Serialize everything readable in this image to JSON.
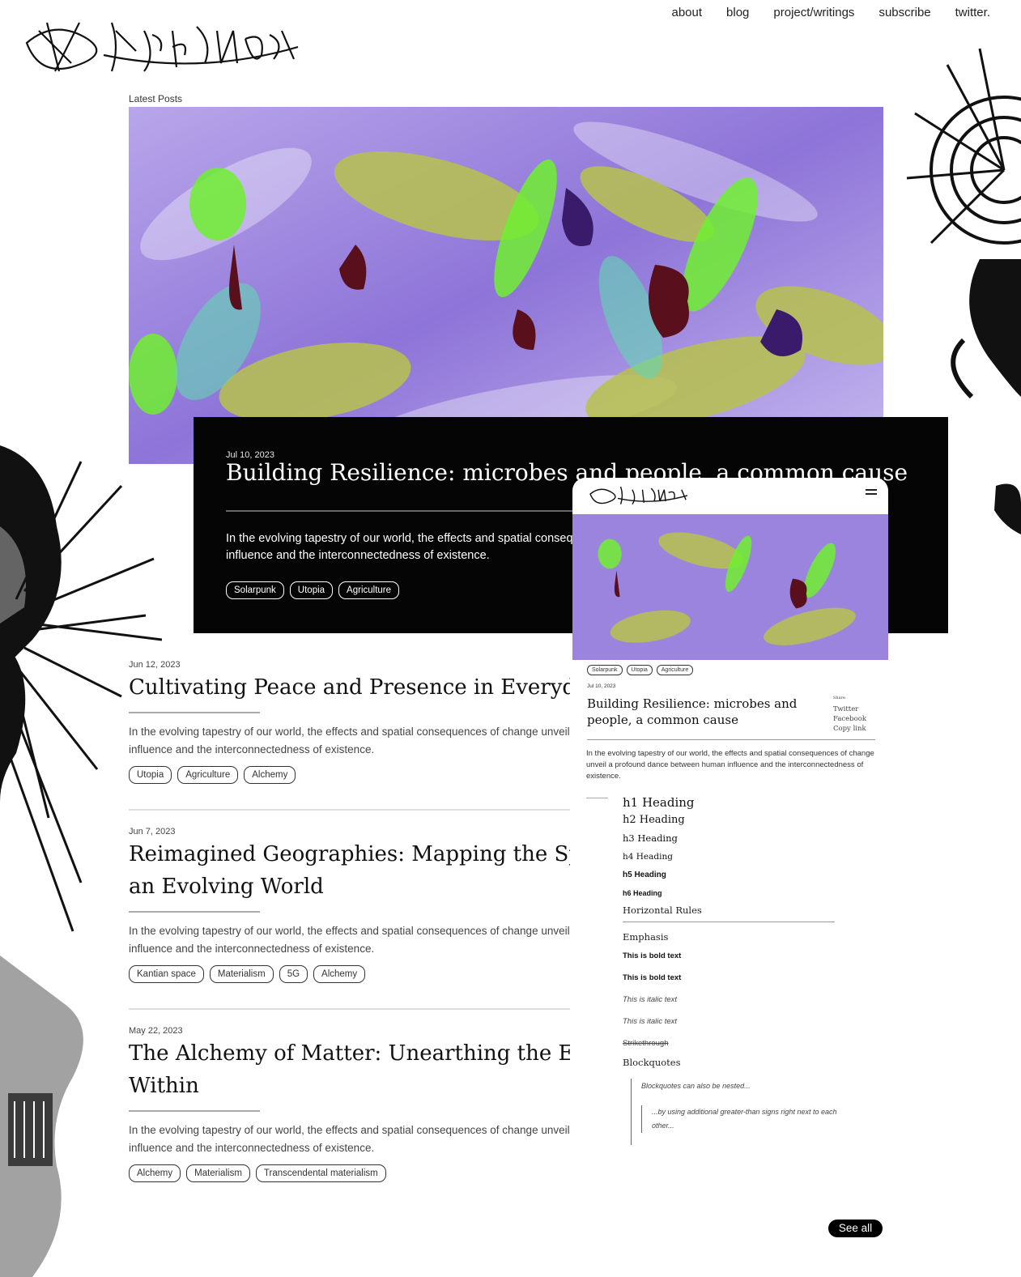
{
  "header": {
    "logo_alt": "Hybris Mongrel",
    "nav": [
      "about",
      "blog",
      "project/writings",
      "subscribe",
      "twitter."
    ]
  },
  "section_label": "Latest Posts",
  "featured": {
    "date": "Jul 10, 2023",
    "title": "Building Resilience: microbes and people, a common cause",
    "excerpt": "In the evolving tapestry of our world, the effects and spatial consequences of change unveil a profound dance between human influence and the interconnectedness of existence.",
    "tags": [
      "Solarpunk",
      "Utopia",
      "Agriculture"
    ]
  },
  "posts": [
    {
      "date": "Jun 12, 2023",
      "title": "Cultivating Peace and Presence in Everyday Life",
      "excerpt_line1": "In the evolving tapestry of our world, the effects and spatial consequences of change unveil a profound dance between human",
      "excerpt_line2": "influence and the interconnectedness of existence.",
      "tags": [
        "Utopia",
        "Agriculture",
        "Alchemy"
      ]
    },
    {
      "date": "Jun 7, 2023",
      "title_line1": "Reimagined Geographies: Mapping the Spatial Consequences of",
      "title_line2": "an Evolving World",
      "excerpt_line1": "In the evolving tapestry of our world, the effects and spatial consequences of change unveil a profound dance between human",
      "excerpt_line2": "influence and the interconnectedness of existence.",
      "tags": [
        "Kantian space",
        "Materialism",
        "5G",
        "Alchemy"
      ]
    },
    {
      "date": "May 22, 2023",
      "title_line1": "The Alchemy of Matter: Unearthing the Eternal Essence",
      "title_line2": "Within",
      "excerpt_line1": "In the evolving tapestry of our world, the effects and spatial consequences of change unveil a profound dance between human",
      "excerpt_line2": "influence and the interconnectedness of existence.",
      "tags": [
        "Alchemy",
        "Materialism",
        "Transcendental materialism"
      ]
    }
  ],
  "mobile": {
    "tags": [
      "Solarpunk",
      "Utopia",
      "Agriculture"
    ],
    "date": "Jul 10, 2023",
    "title": "Building Resilience: microbes and people, a common cause",
    "share_label": "Share",
    "share": [
      "Twitter",
      "Facebook",
      "Copy link"
    ],
    "excerpt": "In the evolving tapestry of our world, the effects and spatial consequences of change unveil a profound dance between human influence and the interconnectedness of existence.",
    "h1": "h1 Heading",
    "h2": "h2 Heading",
    "h3": "h3 Heading",
    "h4": "h4 Heading",
    "h5": "h5 Heading",
    "h6": "h6 Heading",
    "hr_label": "Horizontal Rules",
    "emphasis_label": "Emphasis",
    "bold1": "This is bold text",
    "bold2": "This is bold text",
    "italic1": "This is italic text",
    "italic2": "This is italic text",
    "strike": "Strikethrough",
    "blockquotes_label": "Blockquotes",
    "bq1": "Blockquotes can also be nested...",
    "bq2": "...by using additional greater-than signs right next to each other..."
  },
  "see_all": "See all",
  "colors": {
    "black": "#050505",
    "lavender": "#8f78d6",
    "lime": "#7ff03a",
    "olive": "#a7a040",
    "maroon": "#5a0f1c"
  }
}
